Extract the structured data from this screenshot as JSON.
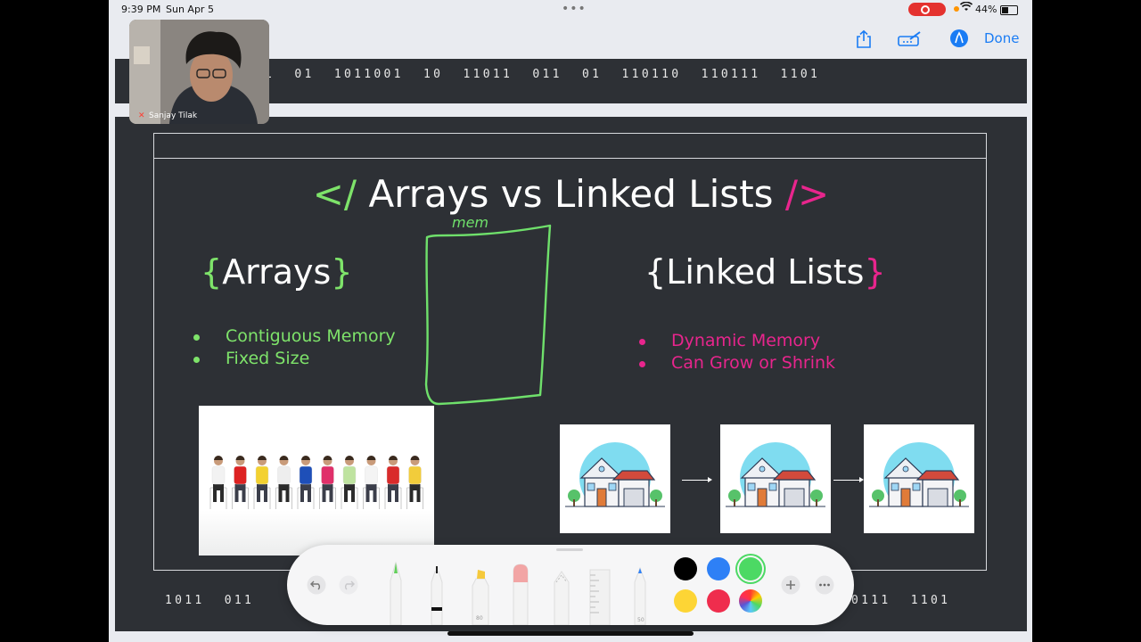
{
  "status_bar": {
    "time": "9:39 PM",
    "date": "Sun Apr 5",
    "battery": "44%"
  },
  "toolbar": {
    "share_icon": "share-icon",
    "markup_icon": "pen-tray-icon",
    "pencil_icon": "pencil-circle-icon",
    "done_label": "Done"
  },
  "webcam": {
    "name": "Sanjay Tilak",
    "mic_icon": "mic-muted-icon"
  },
  "binary": {
    "top": "1  01  1011001  10  11011  011  01  110110  110111  1101",
    "bottom_left": "1011  011",
    "bottom_right": "0111  1101"
  },
  "slide": {
    "title_open": "</",
    "title_text": "Arrays vs Linked Lists",
    "title_close": "/>",
    "handwriting": "mem",
    "arrays": {
      "brace_open": "{",
      "heading": "Arrays",
      "brace_close": "}",
      "bullets": [
        "Contiguous Memory",
        "Fixed Size"
      ]
    },
    "linked_lists": {
      "brace_open": "{",
      "heading": "Linked Lists",
      "brace_close": "}",
      "bullets": [
        "Dynamic Memory",
        "Can Grow or Shrink"
      ]
    }
  },
  "palette": {
    "tools": [
      "pen",
      "fineliner",
      "marker",
      "eraser",
      "lasso",
      "ruler",
      "pencil"
    ],
    "colors": [
      "#000000",
      "#2e80f6",
      "#4cd964",
      "#fdd535",
      "#ef2d4d",
      "rainbow"
    ],
    "marker_label": "80",
    "pencil_label": "50"
  },
  "colors": {
    "accent_green": "#7ee36a",
    "accent_pink": "#e8258d",
    "slide_bg": "#2d3035",
    "ios_blue": "#1a7cf4"
  }
}
